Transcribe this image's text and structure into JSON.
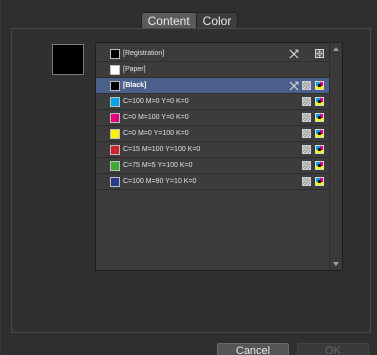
{
  "tabs": [
    {
      "label": "Content",
      "active": true
    },
    {
      "label": "Color",
      "active": false
    }
  ],
  "preview": {
    "color": "#000000"
  },
  "swatches": [
    {
      "label": "[Registration]",
      "color": "#000000",
      "icons": [
        "scissors-x-icon",
        "registration-icon"
      ]
    },
    {
      "label": "[Paper]",
      "color": "#ffffff",
      "icons": []
    },
    {
      "label": "[Black]",
      "color": "#000000",
      "icons": [
        "scissors-x-icon",
        "process-grid-icon",
        "cmyk-icon"
      ],
      "selected": true
    },
    {
      "label": "C=100 M=0 Y=0 K=0",
      "color": "#00a5e6",
      "icons": [
        "process-grid-icon",
        "cmyk-icon"
      ]
    },
    {
      "label": "C=0 M=100 Y=0 K=0",
      "color": "#e4007f",
      "icons": [
        "process-grid-icon",
        "cmyk-icon"
      ]
    },
    {
      "label": "C=0 M=0 Y=100 K=0",
      "color": "#fff000",
      "icons": [
        "process-grid-icon",
        "cmyk-icon"
      ]
    },
    {
      "label": "C=15 M=100 Y=100 K=0",
      "color": "#d2232a",
      "icons": [
        "process-grid-icon",
        "cmyk-icon"
      ]
    },
    {
      "label": "C=75 M=5 Y=100 K=0",
      "color": "#3aa935",
      "icons": [
        "process-grid-icon",
        "cmyk-icon"
      ]
    },
    {
      "label": "C=100 M=90 Y=10 K=0",
      "color": "#2a3b8f",
      "icons": [
        "process-grid-icon",
        "cmyk-icon"
      ]
    }
  ],
  "buttons": {
    "cancel": "Cancel",
    "ok": "OK"
  },
  "colors": {
    "selection": "#4a5f8a"
  }
}
